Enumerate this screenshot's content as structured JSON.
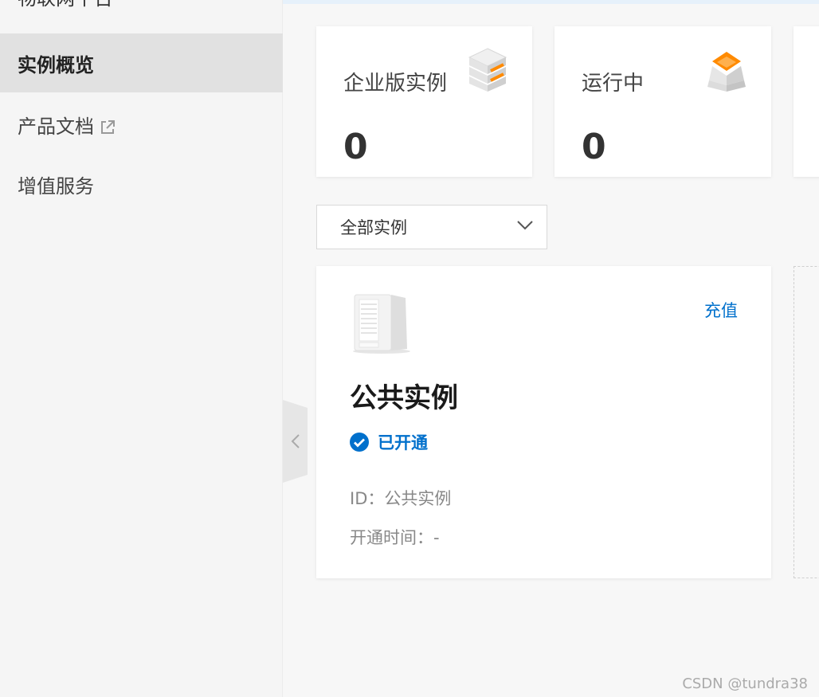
{
  "sidebar": {
    "title": "物联网平台",
    "items": [
      {
        "label": "实例概览",
        "active": true
      },
      {
        "label": "产品文档",
        "external": true
      },
      {
        "label": "增值服务"
      }
    ]
  },
  "stats": [
    {
      "label": "企业版实例",
      "value": "0",
      "icon": "stacked-servers-icon"
    },
    {
      "label": "运行中",
      "value": "0",
      "icon": "pyramid-layers-icon"
    }
  ],
  "filter": {
    "selected": "全部实例"
  },
  "instance": {
    "recharge_label": "充值",
    "title": "公共实例",
    "status": "已开通",
    "id_line": "ID：公共实例",
    "opened_line": "开通时间：-"
  },
  "watermark": "CSDN @tundra38",
  "colors": {
    "accent": "#0070cc",
    "orange": "#ff8a00"
  }
}
